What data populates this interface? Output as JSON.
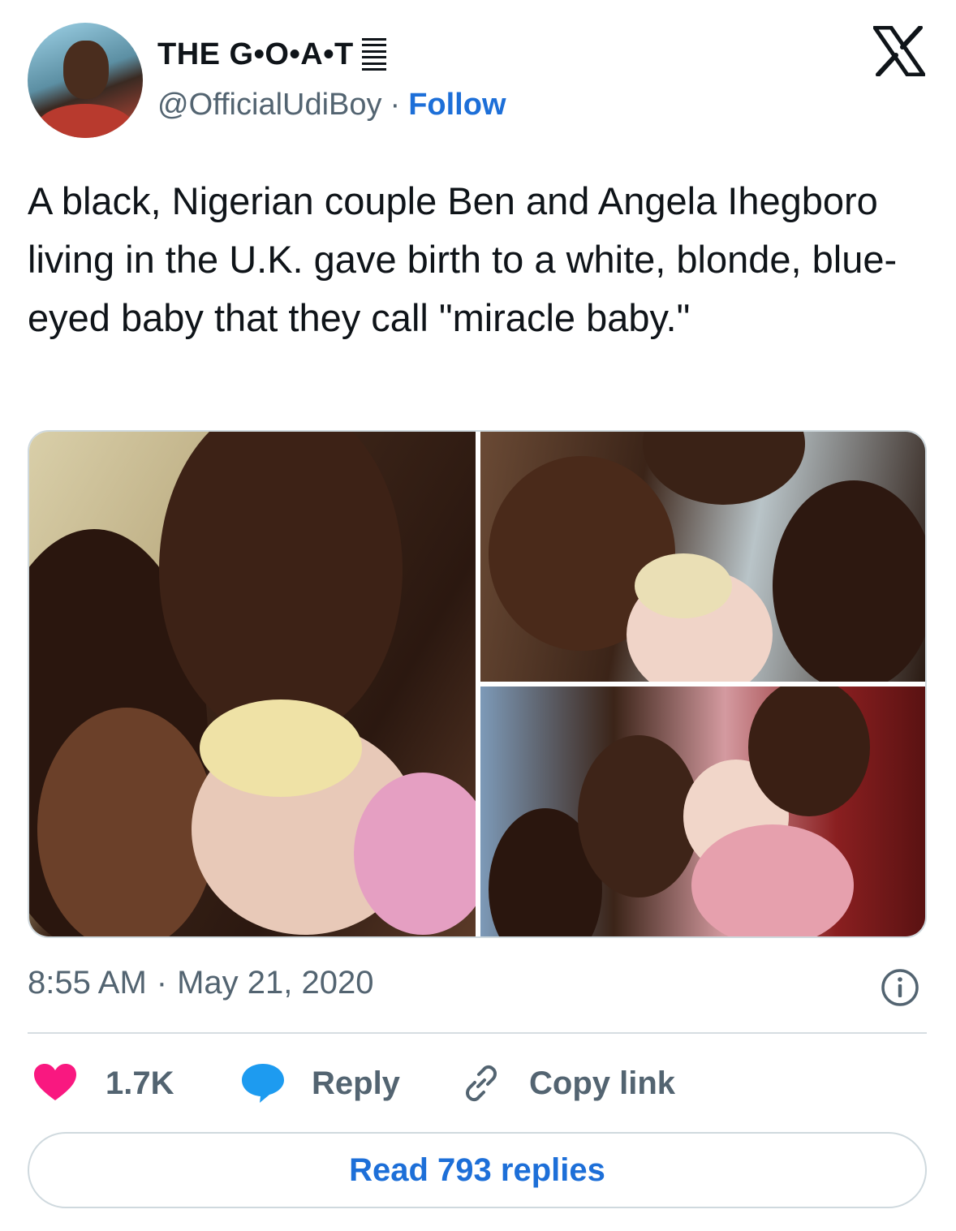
{
  "header": {
    "display_name": "THE G•O•A•T",
    "handle": "@OfficialUdiBoy",
    "separator": "·",
    "follow_label": "Follow"
  },
  "tweet": {
    "text": "A black, Nigerian couple Ben and Angela Ihegboro living in the U.K. gave birth to a white, blonde, blue-eyed baby that they call \"miracle baby.\""
  },
  "meta": {
    "time": "8:55 AM",
    "separator": "·",
    "date": "May 21, 2020"
  },
  "actions": {
    "like_count": "1.7K",
    "reply_label": "Reply",
    "copy_link_label": "Copy link"
  },
  "read_replies_label": "Read 793 replies",
  "colors": {
    "accent_blue": "#1d6fd8",
    "like_pink": "#f91880",
    "reply_blue": "#1d9bf0",
    "muted_text": "#536471"
  },
  "icons": {
    "brand": "x-logo-icon",
    "verified": "verified-bars-icon",
    "info": "info-icon",
    "like": "heart-icon",
    "reply": "speech-bubble-icon",
    "copy": "link-icon"
  }
}
